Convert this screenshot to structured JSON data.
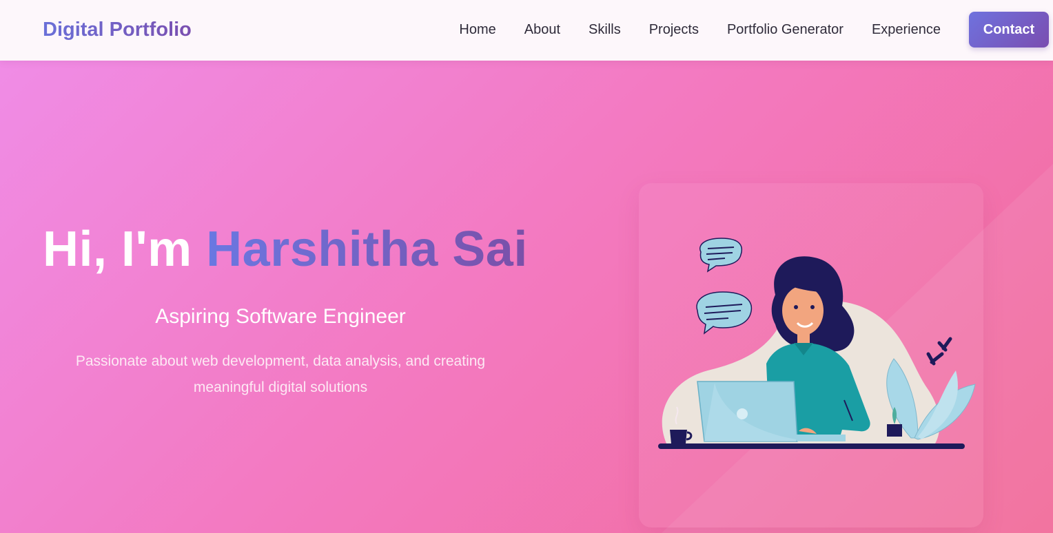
{
  "nav": {
    "brand": "Digital Portfolio",
    "links": [
      {
        "label": "Home"
      },
      {
        "label": "About"
      },
      {
        "label": "Skills"
      },
      {
        "label": "Projects"
      },
      {
        "label": "Portfolio Generator"
      },
      {
        "label": "Experience"
      }
    ],
    "contact_label": "Contact"
  },
  "hero": {
    "greeting": "Hi, I'm",
    "name": "Harshitha Sai",
    "subtitle": "Aspiring Software Engineer",
    "description": "Passionate about web development, data analysis, and creating meaningful digital solutions"
  },
  "illustration": {
    "icon": "woman-at-laptop-illustration"
  },
  "colors": {
    "accent_start": "#6a70d8",
    "accent_end": "#7a4fb0",
    "hero_start": "#f08ce6",
    "hero_end": "#f26a98",
    "nav_bg": "#fdf7fb"
  }
}
